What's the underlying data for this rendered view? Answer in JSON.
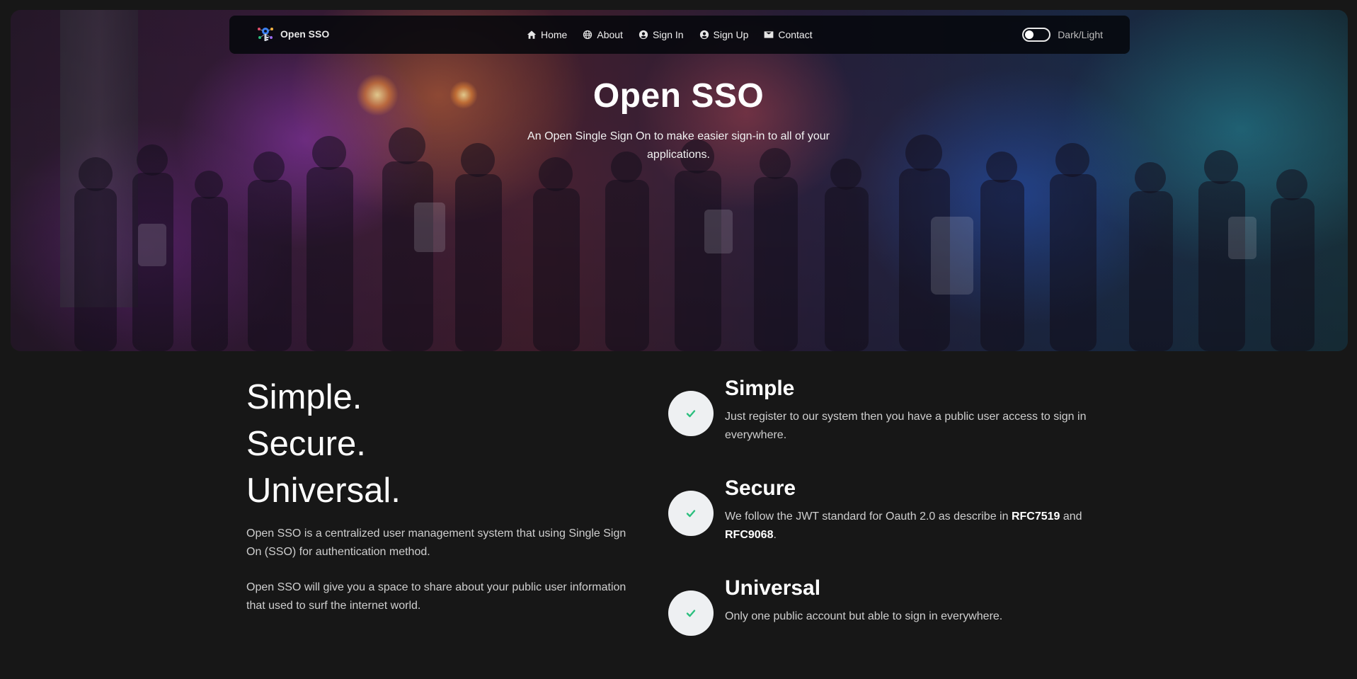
{
  "navbar": {
    "brand": "Open SSO",
    "links": [
      {
        "label": "Home",
        "icon": "home-icon"
      },
      {
        "label": "About",
        "icon": "globe-icon"
      },
      {
        "label": "Sign In",
        "icon": "user-circle-icon"
      },
      {
        "label": "Sign Up",
        "icon": "user-circle-icon"
      },
      {
        "label": "Contact",
        "icon": "envelope-icon"
      }
    ],
    "theme_toggle_label": "Dark/Light"
  },
  "hero": {
    "title": "Open SSO",
    "subtitle": "An Open Single Sign On to make easier sign-in to all of your applications."
  },
  "intro": {
    "tagline": [
      "Simple.",
      "Secure.",
      "Universal."
    ],
    "paragraphs": [
      "Open SSO is a centralized user management system that using Single Sign On (SSO) for authentication method.",
      "Open SSO will give you a space to share about your public user information that used to surf the internet world."
    ]
  },
  "features": [
    {
      "title": "Simple",
      "body": "Just register to our system then you have a public user access to sign in everywhere."
    },
    {
      "title": "Secure",
      "body_before": "We follow the JWT standard for Oauth 2.0 as describe in ",
      "rfc_1": "RFC7519",
      "body_middle": " and ",
      "rfc_2": "RFC9068",
      "body_after": "."
    },
    {
      "title": "Universal",
      "body": "Only one public account but able to sign in everywhere."
    }
  ],
  "colors": {
    "background": "#171717",
    "check_accent": "#2bbf7e",
    "check_bg": "#eef0f2"
  }
}
